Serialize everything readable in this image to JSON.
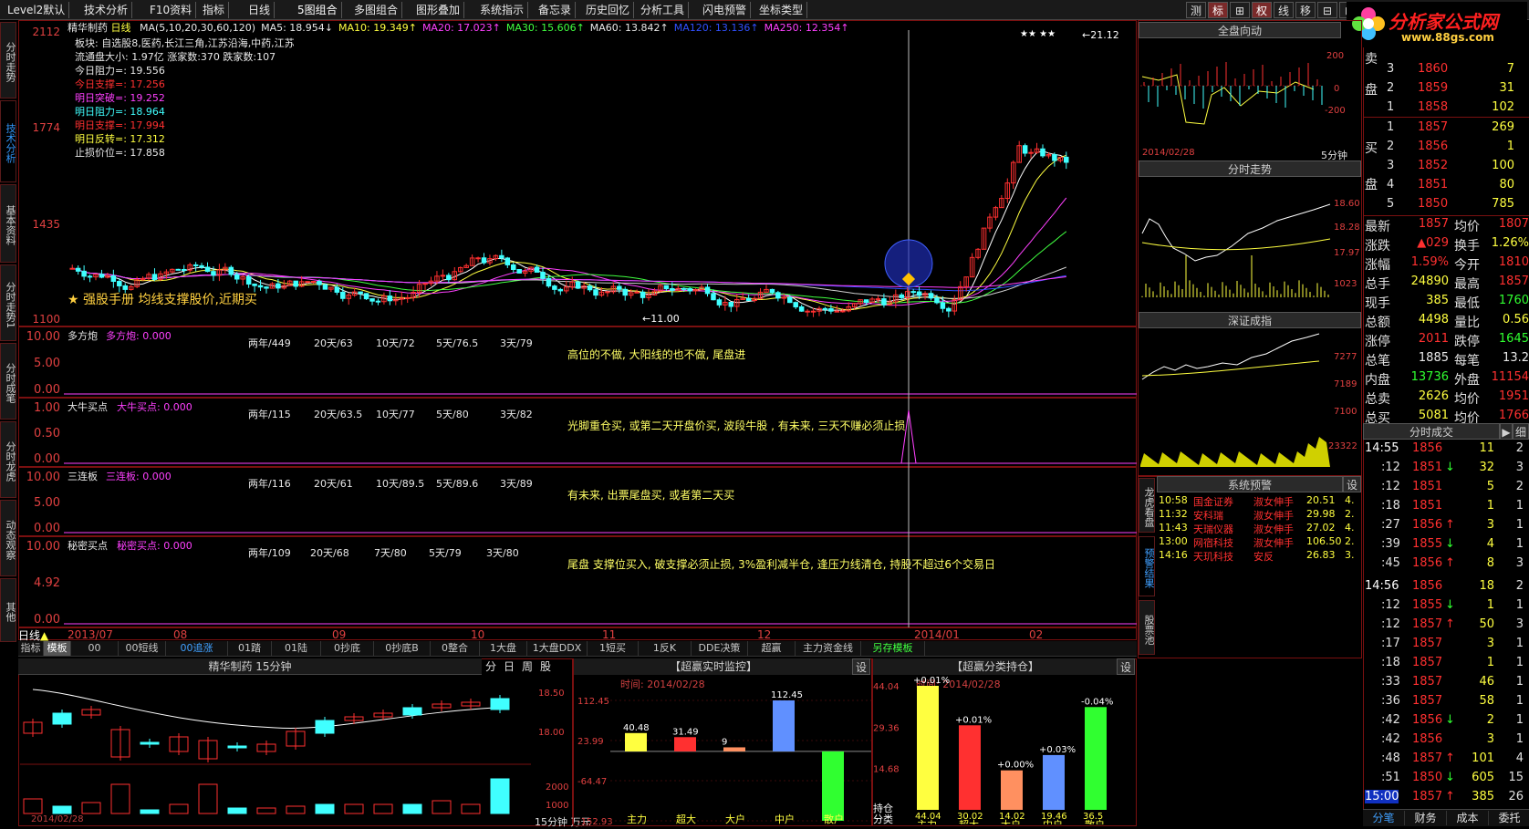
{
  "menus": [
    "Level2默认",
    "技术分析",
    "F10资料",
    "指标",
    "日线",
    "5图组合",
    "多图组合",
    "图形叠加",
    "系统指示",
    "备忘录",
    "历史回忆",
    "分析工具",
    "闪电预警",
    "坐标类型"
  ],
  "top_buttons": [
    "测",
    "标",
    "⊞",
    "权",
    "线",
    "移",
    "⊟",
    "⊡"
  ],
  "logo": {
    "brand": "分析家公式网",
    "url": "www.88gs.com"
  },
  "side_tabs": [
    "分时走势",
    "技术分析",
    "基本资料",
    "分时走势1",
    "分时成笔",
    "分时龙虎",
    "动态观察",
    "其他"
  ],
  "stock": {
    "name": "精华制药",
    "period": "日线"
  },
  "ma_line": [
    {
      "text": "MA(5,10,20,30,60,120)",
      "color": "#e8e8e8"
    },
    {
      "text": "MA5: 18.954↓",
      "color": "#e8e8e8"
    },
    {
      "text": "MA10: 19.349↑",
      "color": "#ffff40"
    },
    {
      "text": "MA20: 17.023↑",
      "color": "#ff40ff"
    },
    {
      "text": "MA30: 15.606↑",
      "color": "#40ff40"
    },
    {
      "text": "MA60: 13.842↑",
      "color": "#e8e8e8"
    },
    {
      "text": "MA120: 13.136↑",
      "color": "#3050ff"
    },
    {
      "text": "MA250: 12.354↑",
      "color": "#ff40ff"
    }
  ],
  "info_lines": [
    {
      "text": "板块: 自选股8,医药,长江三角,江苏沿海,中药,江苏",
      "color": "#e8e8e8"
    },
    {
      "text": "流通盘大小: 1.97亿  涨家数:370  跌家数:107",
      "color": "#e8e8e8"
    },
    {
      "text": "今日阻力=: 19.556",
      "color": "#e8e8e8"
    },
    {
      "text": "今日支撑=: 17.256",
      "color": "#ff3030"
    },
    {
      "text": "明日突破=: 19.252",
      "color": "#ff40ff"
    },
    {
      "text": "明日阻力=: 18.964",
      "color": "#40ffff"
    },
    {
      "text": "明日支撑=: 17.994",
      "color": "#ff3030"
    },
    {
      "text": "明日反转=: 17.312",
      "color": "#ffff40"
    },
    {
      "text": "止损价位=: 17.858",
      "color": "#e8e8e8"
    }
  ],
  "main_axis": [
    "2112",
    "1774",
    "1435",
    "1100"
  ],
  "main_annot": {
    "high": "←21.12",
    "low": "←11.00",
    "stars": "★★  ★★",
    "banner": "★ 强股手册  均线支撑股价,近期买"
  },
  "sub_panels": [
    {
      "title": "多方炮",
      "label": "多方炮: 0.000",
      "axis": [
        "10.00",
        "5.00",
        "0.00"
      ],
      "stats": [
        "两年/449",
        "20天/63",
        "10天/72",
        "5天/76.5",
        "3天/79"
      ],
      "note": "高位的不做, 大阳线的也不做, 尾盘进"
    },
    {
      "title": "大牛买点",
      "label": "大牛买点: 0.000",
      "axis": [
        "1.00",
        "0.50",
        "0.00"
      ],
      "stats": [
        "两年/115",
        "20天/63.5",
        "10天/77",
        "5天/80",
        "3天/82"
      ],
      "note": "光脚重仓买, 或第二天开盘价买, 波段牛股 , 有未来, 三天不赚必须止损"
    },
    {
      "title": "三连板",
      "label": "三连板: 0.000",
      "axis": [
        "10.00",
        "5.00",
        "0.00"
      ],
      "stats": [
        "两年/116",
        "20天/61",
        "10天/89.5",
        "5天/89.6",
        "3天/89"
      ],
      "note": "有未来, 出票尾盘买, 或者第二天买"
    },
    {
      "title": "秘密买点",
      "label": "秘密买点: 0.000",
      "axis": [
        "10.00",
        "4.92",
        "0.00"
      ],
      "stats": [
        "两年/109",
        "20天/68",
        "7天/80",
        "5天/79",
        "3天/80"
      ],
      "note": "尾盘 支撑位买入, 破支撑必须止损, 3%盈利减半仓, 逢压力线清仓, 持股不超过6个交易日"
    }
  ],
  "date_axis": [
    "2013/07",
    "08",
    "09",
    "10",
    "11",
    "12",
    "2014/01",
    "02"
  ],
  "period_label": "日线",
  "indicator_tabs": [
    "指标",
    "模板",
    "00",
    "00短线",
    "00追涨",
    "01踏",
    "01陆",
    "0抄底",
    "0抄底B",
    "0整合",
    "1大盘",
    "1大盘DDX",
    "1短买",
    "1反K",
    "DDE决策",
    "超赢",
    "主力资金线",
    "另存模板"
  ],
  "panel15": {
    "title": "精华制药 15分钟",
    "tabs": [
      "分",
      "日",
      "周",
      "股"
    ],
    "axis": [
      "18.50",
      "18.00",
      "2000",
      "1000"
    ],
    "date": "2014/02/28",
    "unit": "15分钟 万元"
  },
  "realtime": {
    "title": "【超赢实时监控】",
    "set": "设",
    "time": "时间: 2014/02/28",
    "axis": [
      "112.45",
      "23.99",
      "-64.47",
      "-152.93"
    ],
    "bars": [
      {
        "name": "主力",
        "value": 40.48,
        "color": "#ffff40"
      },
      {
        "name": "超大",
        "value": 31.49,
        "color": "#ff3030"
      },
      {
        "name": "大户",
        "value": 9,
        "color": "#ff9060"
      },
      {
        "name": "中户",
        "value": 112.45,
        "color": "#6090ff"
      },
      {
        "name": "散户",
        "value": -152.93,
        "color": "#30ff30"
      }
    ]
  },
  "holdings": {
    "title": "【超赢分类持仓】",
    "set": "设",
    "time": "时间: 2014/02/28",
    "axis": [
      "44.04",
      "29.36",
      "14.68"
    ],
    "ylabel": [
      "持仓",
      "分类"
    ],
    "bars": [
      {
        "name": "主力",
        "value": 44.04,
        "change": "+0.01%",
        "color": "#ffff40"
      },
      {
        "name": "超大",
        "value": 30.02,
        "change": "+0.01%",
        "color": "#ff3030"
      },
      {
        "name": "大户",
        "value": 14.02,
        "change": "+0.00%",
        "color": "#ff9060"
      },
      {
        "name": "中户",
        "value": 19.46,
        "change": "+0.03%",
        "color": "#6090ff"
      },
      {
        "name": "散户",
        "value": 36.5,
        "change": "-0.04%",
        "color": "#30ff30"
      }
    ]
  },
  "mini": {
    "whole_title": "全盘向动",
    "whole_axis": [
      "200",
      "0",
      "-200"
    ],
    "whole_date": "2014/02/28",
    "whole_period": "5分钟",
    "time_title": "分时走势",
    "time_axis": [
      "18.60",
      "18.28",
      "17.97",
      "1023"
    ],
    "sz_title": "深证成指",
    "sz_axis": [
      "7277",
      "7189",
      "7100",
      "23322"
    ]
  },
  "alert": {
    "title": "系统预警",
    "set": "设",
    "rows": [
      {
        "time": "10:58",
        "name": "国金证券",
        "sig": "淑女伸手",
        "price": "20.51",
        "x": "4."
      },
      {
        "time": "11:32",
        "name": "安科瑞",
        "sig": "淑女伸手",
        "price": "29.98",
        "x": "2."
      },
      {
        "time": "11:43",
        "name": "天瑞仪器",
        "sig": "淑女伸手",
        "price": "27.02",
        "x": "4."
      },
      {
        "time": "13:00",
        "name": "网宿科技",
        "sig": "淑女伸手",
        "price": "106.50",
        "x": "2."
      },
      {
        "time": "14:16",
        "name": "天玑科技",
        "sig": "安反",
        "price": "26.83",
        "x": "3."
      }
    ],
    "side": [
      "龙虎看盘",
      "预警结果",
      "股票池"
    ]
  },
  "orderbook": {
    "sell_label": [
      "卖",
      "盘"
    ],
    "buy_label": [
      "买",
      "盘"
    ],
    "sell": [
      {
        "n": "3",
        "p": "1860",
        "v": "7"
      },
      {
        "n": "2",
        "p": "1859",
        "v": "31"
      },
      {
        "n": "1",
        "p": "1858",
        "v": "102"
      }
    ],
    "buy": [
      {
        "n": "1",
        "p": "1857",
        "v": "269"
      },
      {
        "n": "2",
        "p": "1856",
        "v": "1"
      },
      {
        "n": "3",
        "p": "1852",
        "v": "100"
      },
      {
        "n": "4",
        "p": "1851",
        "v": "80"
      },
      {
        "n": "5",
        "p": "1850",
        "v": "785"
      }
    ]
  },
  "quote": [
    {
      "k1": "最新",
      "v1": "1857",
      "c1": "r",
      "k2": "均价",
      "v2": "1807",
      "c2": "r"
    },
    {
      "k1": "涨跌",
      "v1": "▲029",
      "c1": "r",
      "k2": "换手",
      "v2": "1.26%",
      "c2": "y"
    },
    {
      "k1": "涨幅",
      "v1": "1.59%",
      "c1": "r",
      "k2": "今开",
      "v2": "1810",
      "c2": "r"
    },
    {
      "k1": "总手",
      "v1": "24890",
      "c1": "y",
      "k2": "最高",
      "v2": "1857",
      "c2": "r"
    },
    {
      "k1": "现手",
      "v1": "385",
      "c1": "y",
      "k2": "最低",
      "v2": "1760",
      "c2": "g"
    },
    {
      "k1": "总额",
      "v1": "4498",
      "c1": "y",
      "k2": "量比",
      "v2": "0.56",
      "c2": "y"
    },
    {
      "k1": "涨停",
      "v1": "2011",
      "c1": "r",
      "k2": "跌停",
      "v2": "1645",
      "c2": "g"
    },
    {
      "k1": "总笔",
      "v1": "1885",
      "c1": "w",
      "k2": "每笔",
      "v2": "13.2",
      "c2": "w"
    },
    {
      "k1": "内盘",
      "v1": "13736",
      "c1": "g",
      "k2": "外盘",
      "v2": "11154",
      "c2": "r"
    },
    {
      "k1": "总卖",
      "v1": "2626",
      "c1": "y",
      "k2": "均价",
      "v2": "1951",
      "c2": "r"
    },
    {
      "k1": "总买",
      "v1": "5081",
      "c1": "y",
      "k2": "均价",
      "v2": "1766",
      "c2": "r"
    }
  ],
  "ticks_title": "分时成交",
  "ticks_arrow": "▶",
  "ticks_more": "细",
  "ticks": [
    {
      "t": "14:55",
      "p": "1856",
      "pc": "r",
      "a": "",
      "v": "11",
      "n": "2"
    },
    {
      "t": ":12",
      "p": "1851",
      "pc": "r",
      "a": "↓",
      "v": "32",
      "n": "3"
    },
    {
      "t": ":12",
      "p": "1851",
      "pc": "r",
      "a": "",
      "v": "5",
      "n": "2"
    },
    {
      "t": ":18",
      "p": "1851",
      "pc": "r",
      "a": "",
      "v": "1",
      "n": "1"
    },
    {
      "t": ":27",
      "p": "1856",
      "pc": "r",
      "a": "↑",
      "v": "3",
      "n": "1"
    },
    {
      "t": ":39",
      "p": "1855",
      "pc": "r",
      "a": "↓",
      "v": "4",
      "n": "1"
    },
    {
      "t": ":45",
      "p": "1856",
      "pc": "r",
      "a": "↑",
      "v": "8",
      "n": "3"
    },
    {
      "t": "14:56",
      "p": "1856",
      "pc": "r",
      "a": "",
      "v": "18",
      "n": "2"
    },
    {
      "t": ":12",
      "p": "1855",
      "pc": "r",
      "a": "↓",
      "v": "1",
      "n": "1"
    },
    {
      "t": ":12",
      "p": "1857",
      "pc": "r",
      "a": "↑",
      "v": "50",
      "n": "3"
    },
    {
      "t": ":17",
      "p": "1857",
      "pc": "r",
      "a": "",
      "v": "3",
      "n": "1"
    },
    {
      "t": ":18",
      "p": "1857",
      "pc": "r",
      "a": "",
      "v": "1",
      "n": "1"
    },
    {
      "t": ":33",
      "p": "1857",
      "pc": "r",
      "a": "",
      "v": "46",
      "n": "1"
    },
    {
      "t": ":36",
      "p": "1857",
      "pc": "r",
      "a": "",
      "v": "58",
      "n": "1"
    },
    {
      "t": ":42",
      "p": "1856",
      "pc": "r",
      "a": "↓",
      "v": "2",
      "n": "1"
    },
    {
      "t": ":42",
      "p": "1856",
      "pc": "r",
      "a": "",
      "v": "3",
      "n": "1"
    },
    {
      "t": ":48",
      "p": "1857",
      "pc": "r",
      "a": "↑",
      "v": "101",
      "n": "4"
    },
    {
      "t": ":51",
      "p": "1850",
      "pc": "r",
      "a": "↓",
      "v": "605",
      "n": "15"
    },
    {
      "t": "15:00",
      "p": "1857",
      "pc": "r",
      "a": "↑",
      "v": "385",
      "n": "26"
    }
  ],
  "bottom_tabs": [
    "分笔",
    "财务",
    "成本",
    "委托"
  ]
}
